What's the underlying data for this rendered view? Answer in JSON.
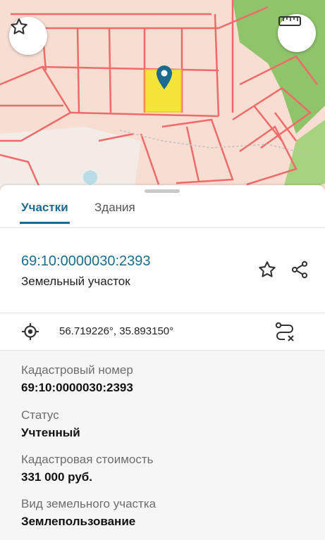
{
  "tabs": [
    {
      "label": "Участки",
      "active": true
    },
    {
      "label": "Здания",
      "active": false
    }
  ],
  "parcel": {
    "cadastral_link": "69:10:0000030:2393",
    "type_label": "Земельный участок"
  },
  "coords": {
    "text": "56.719226°, 35.893150°"
  },
  "details": [
    {
      "label": "Кадастровый номер",
      "value": "69:10:0000030:2393"
    },
    {
      "label": "Статус",
      "value": "Учтенный"
    },
    {
      "label": "Кадастровая стоимость",
      "value": "331 000 руб."
    },
    {
      "label": "Вид земельного участка",
      "value": "Землепользование"
    }
  ],
  "icons": {
    "map_favorite": "star-icon",
    "map_ruler": "ruler-icon",
    "marker": "location-pin-icon",
    "favorite": "star-icon",
    "share": "share-icon",
    "locate": "crosshair-icon",
    "route": "route-icon"
  },
  "colors": {
    "accent": "#1c6b8e",
    "parcel_line": "#ef6a6a",
    "map_bg": "#f7ddd2",
    "forest": "#8fc46a",
    "selected_parcel": "#f5e43a"
  }
}
